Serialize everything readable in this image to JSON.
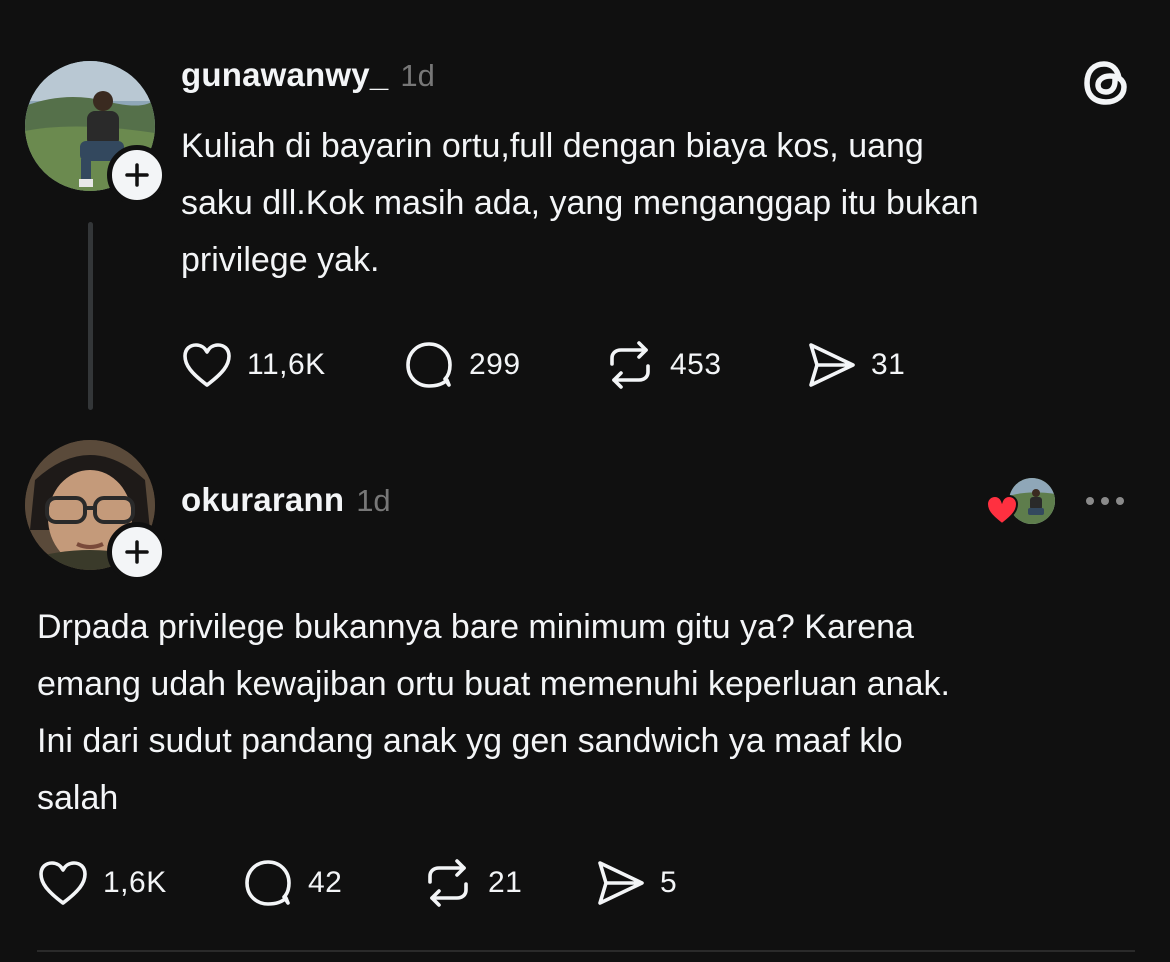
{
  "post": {
    "username": "gunawanwy_",
    "time": "1d",
    "text": "Kuliah di bayarin ortu,full dengan biaya kos, uang\nsaku dll.Kok masih ada, yang menganggap itu bukan\nprivilege yak.",
    "stats": {
      "likes": "11,6K",
      "replies": "299",
      "reposts": "453",
      "shares": "31"
    }
  },
  "reply": {
    "username": "okurarann",
    "time": "1d",
    "text": "Drpada privilege bukannya bare minimum gitu ya? Karena\nemang udah kewajiban ortu buat memenuhi keperluan anak.\nIni dari sudut pandang anak yg gen sandwich ya maaf klo\nsalah",
    "stats": {
      "likes": "1,6K",
      "replies": "42",
      "reposts": "21",
      "shares": "5"
    }
  },
  "icons": {
    "logo": "threads-logo-icon",
    "like": "heart-icon",
    "reply": "comment-bubble-icon",
    "repost": "repost-icon",
    "share": "send-icon",
    "more": "more-dots-icon",
    "liked_by_author": "red-heart-icon"
  },
  "colors": {
    "background": "#101010",
    "text": "#f3f5f7",
    "secondary": "#777777",
    "like_red": "#ff3040"
  }
}
